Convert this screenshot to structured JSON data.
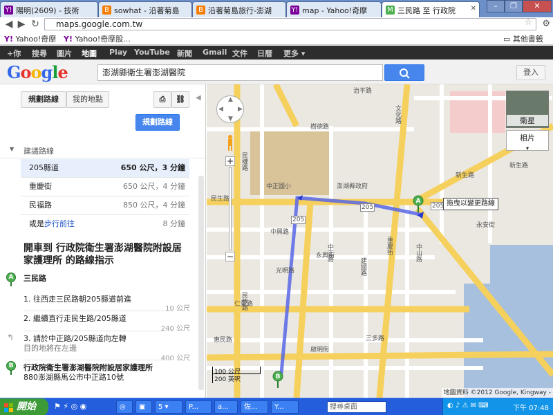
{
  "browser": {
    "tabs": [
      {
        "label": "陽明(2609) - 技術",
        "icon": "Y!"
      },
      {
        "label": "sowhat - 沿著菊島",
        "icon": "B"
      },
      {
        "label": "沿著菊島旅行-澎湖",
        "icon": "B"
      },
      {
        "label": "map - Yahoo!奇摩",
        "icon": "Y!"
      },
      {
        "label": "三民路 至 行政院",
        "icon": "M"
      }
    ],
    "url": "maps.google.com.tw",
    "bookmarks": [
      "Yahoo!奇摩",
      "Yahoo!奇摩股...",
      "其他書籤"
    ]
  },
  "gbar": [
    "+你",
    "搜尋",
    "圖片",
    "地圖",
    "Play",
    "YouTube",
    "新聞",
    "Gmail",
    "文件",
    "日曆",
    "更多 ▾"
  ],
  "header": {
    "logo": "Google",
    "search_value": "澎湖縣衛生署澎湖醫院",
    "login": "登入"
  },
  "panel": {
    "tab_directions": "規劃路線",
    "tab_mymaps": "我的地點",
    "plan_button": "規劃路線",
    "suggested": "建議路線",
    "routes": [
      {
        "name": "205縣道",
        "dist": "650 公尺，3 分鐘"
      },
      {
        "name": "重慶街",
        "dist": "650 公尺，4 分鐘"
      },
      {
        "name": "民福路",
        "dist": "850 公尺，4 分鐘"
      }
    ],
    "walk_prefix": "或是",
    "walk_link": "步行前往",
    "walk_time": "8 分鐘",
    "heading": "開車到 行政院衛生署澎湖醫院附設居家護理所 的路線指示",
    "origin": "三民路",
    "steps": [
      {
        "text": "1. 往西走三民路朝205縣道前進",
        "dist": "10 公尺"
      },
      {
        "text": "2. 繼續直行走民生路/205縣道",
        "dist": "240 公尺"
      },
      {
        "text": "3. 請於中正路/205縣道向左轉",
        "sub": "目的地將在左邊",
        "dist": "400 公尺"
      }
    ],
    "dest_name": "行政院衛生署澎湖醫院附設居家護理所",
    "dest_addr": "880澎湖縣馬公市中正路10號"
  },
  "map": {
    "labels": [
      "治平路",
      "樹德路",
      "文化路",
      "民權路",
      "中正國小",
      "澎湖縣政府",
      "民生路",
      "新生路",
      "中興路",
      "永興街",
      "光明路",
      "仁愛路",
      "惠民路",
      "中正路",
      "重慶街",
      "建國路",
      "民族路",
      "啟明街",
      "永安街",
      "三多路",
      "中山路",
      "新生路",
      "205",
      "205",
      "205"
    ],
    "satellite": "衛星",
    "photo": "相片",
    "drag_tip": "拖曳以變更路線",
    "copyright": "地圖資料 ©2012 Google, Kingway -",
    "scale_m": "100 公尺",
    "scale_ft": "200 英呎",
    "colors": {
      "route": "#5867e8",
      "major_road": "#f6d05c",
      "minor_road": "#ffffff",
      "park": "#d9c49a",
      "water": "#a7c0de"
    }
  },
  "taskbar": {
    "start": "開始",
    "tasks": [
      "5 ▾",
      "P...",
      "a...",
      "佐...",
      "Y..."
    ],
    "search_placeholder": "搜尋桌面",
    "clock": "下午 07:48"
  }
}
